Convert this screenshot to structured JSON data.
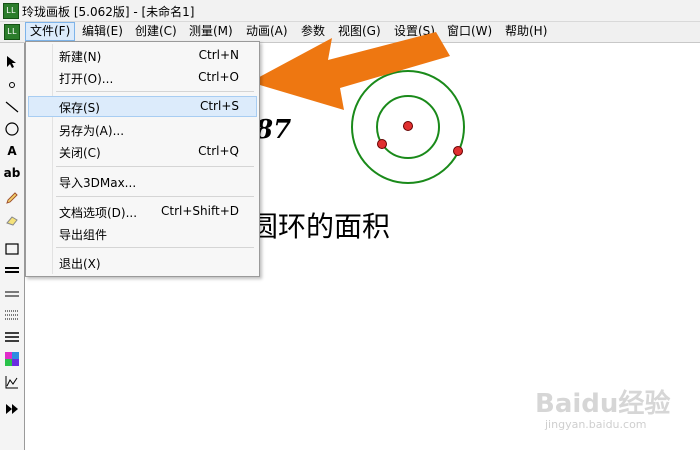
{
  "window": {
    "title": "玲珑画板 [5.062版] - [未命名1]"
  },
  "menubar": {
    "items": [
      {
        "label": "文件(F)"
      },
      {
        "label": "编辑(E)"
      },
      {
        "label": "创建(C)"
      },
      {
        "label": "测量(M)"
      },
      {
        "label": "动画(A)"
      },
      {
        "label": "参数"
      },
      {
        "label": "视图(G)"
      },
      {
        "label": "设置(S)"
      },
      {
        "label": "窗口(W)"
      },
      {
        "label": "帮助(H)"
      }
    ]
  },
  "file_menu": {
    "items": [
      {
        "label": "新建(N)",
        "shortcut": "Ctrl+N"
      },
      {
        "label": "打开(O)...",
        "shortcut": "Ctrl+O"
      },
      {
        "label": "保存(S)",
        "shortcut": "Ctrl+S"
      },
      {
        "label": "另存为(A)...",
        "shortcut": ""
      },
      {
        "label": "关闭(C)",
        "shortcut": "Ctrl+Q"
      },
      {
        "label": "导入3DMax...",
        "shortcut": ""
      },
      {
        "label": "文档选项(D)...",
        "shortcut": "Ctrl+Shift+D"
      },
      {
        "label": "导出组件",
        "shortcut": ""
      },
      {
        "label": "退出(X)",
        "shortcut": ""
      }
    ]
  },
  "toolbar": {
    "tools": [
      {
        "icon": "pointer-icon"
      },
      {
        "icon": "point-icon"
      },
      {
        "icon": "line-icon"
      },
      {
        "icon": "circle-icon"
      },
      {
        "icon": "text-icon",
        "label": "A"
      },
      {
        "icon": "label-text-icon",
        "label": "ab"
      },
      {
        "icon": "pencil-icon"
      },
      {
        "icon": "eraser-icon"
      },
      {
        "icon": "rectangle-icon"
      },
      {
        "icon": "thick-line-icon"
      },
      {
        "icon": "double-line-icon"
      },
      {
        "icon": "dotted-lines-icon"
      },
      {
        "icon": "lines-icon"
      },
      {
        "icon": "color-icon"
      },
      {
        "icon": "graph-icon"
      },
      {
        "icon": "play-forward-icon"
      }
    ]
  },
  "canvas": {
    "number_text": "87",
    "title_text": "圆环的面积",
    "circle_color": "#1a8a1a",
    "point_color": "#e03030",
    "arrow_color": "#ee7711"
  },
  "watermark": {
    "brand": "Baidu经验",
    "url": "jingyan.baidu.com"
  }
}
